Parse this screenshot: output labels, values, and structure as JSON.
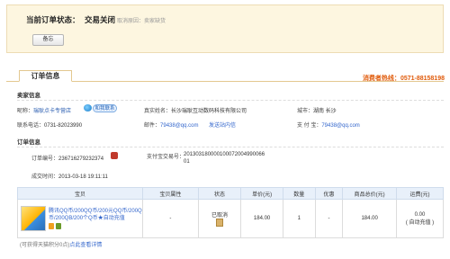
{
  "status": {
    "label": "当前订单状态：",
    "value": "交易关闭",
    "note": "取消原因：卖家缺货",
    "remark_button": "备忘"
  },
  "tab": {
    "label": "订单信息"
  },
  "hotline": {
    "label": "消费者热线：",
    "number": "0571-88158198"
  },
  "seller": {
    "section_title": "卖家信息",
    "nickname_label": "昵称：",
    "nickname": "瑞耿点卡专营店",
    "contact_badge": "和我联系",
    "realname_label": "真实姓名：",
    "realname": "长沙瑞耿互动数码科技有限公司",
    "city_label": "城市：",
    "city": "湖南 长沙",
    "phone_label": "联系电话：",
    "phone": "0731-82023990",
    "email_label": "邮件：",
    "email": "79438@qq.com",
    "send_message": "发送站内信",
    "alipay_label": "支 付 宝：",
    "alipay": "79438@qq.com"
  },
  "order": {
    "section_title": "订单信息",
    "order_no_label": "订单编号：",
    "order_no": "236716279232374",
    "alipay_tx_label": "支付宝交易号：",
    "alipay_tx_line1": "201303180000100072004990066",
    "alipay_tx_line2": "01",
    "created_label": "成交时间：",
    "created_time": "2013-03-18 19:11:11"
  },
  "items_table": {
    "headers": [
      "宝贝",
      "宝贝属性",
      "状态",
      "单价(元)",
      "数量",
      "优惠",
      "商品总价(元)",
      "运费(元)"
    ],
    "rows": [
      {
        "title_line1": "腾讯QQ币/200QQ币/200元QQ币/200Q",
        "title_line2": "币/200QB/200个Q币★自动充值",
        "attributes": "-",
        "status": "已取消",
        "unit_price": "184.00",
        "quantity": "1",
        "discount": "-",
        "total": "184.00",
        "shipping": "0.00",
        "shipping_note": "( 自动充值 )"
      }
    ]
  },
  "footer": {
    "text": "(可获得天猫积分0点)",
    "link": "点此查看详情"
  }
}
